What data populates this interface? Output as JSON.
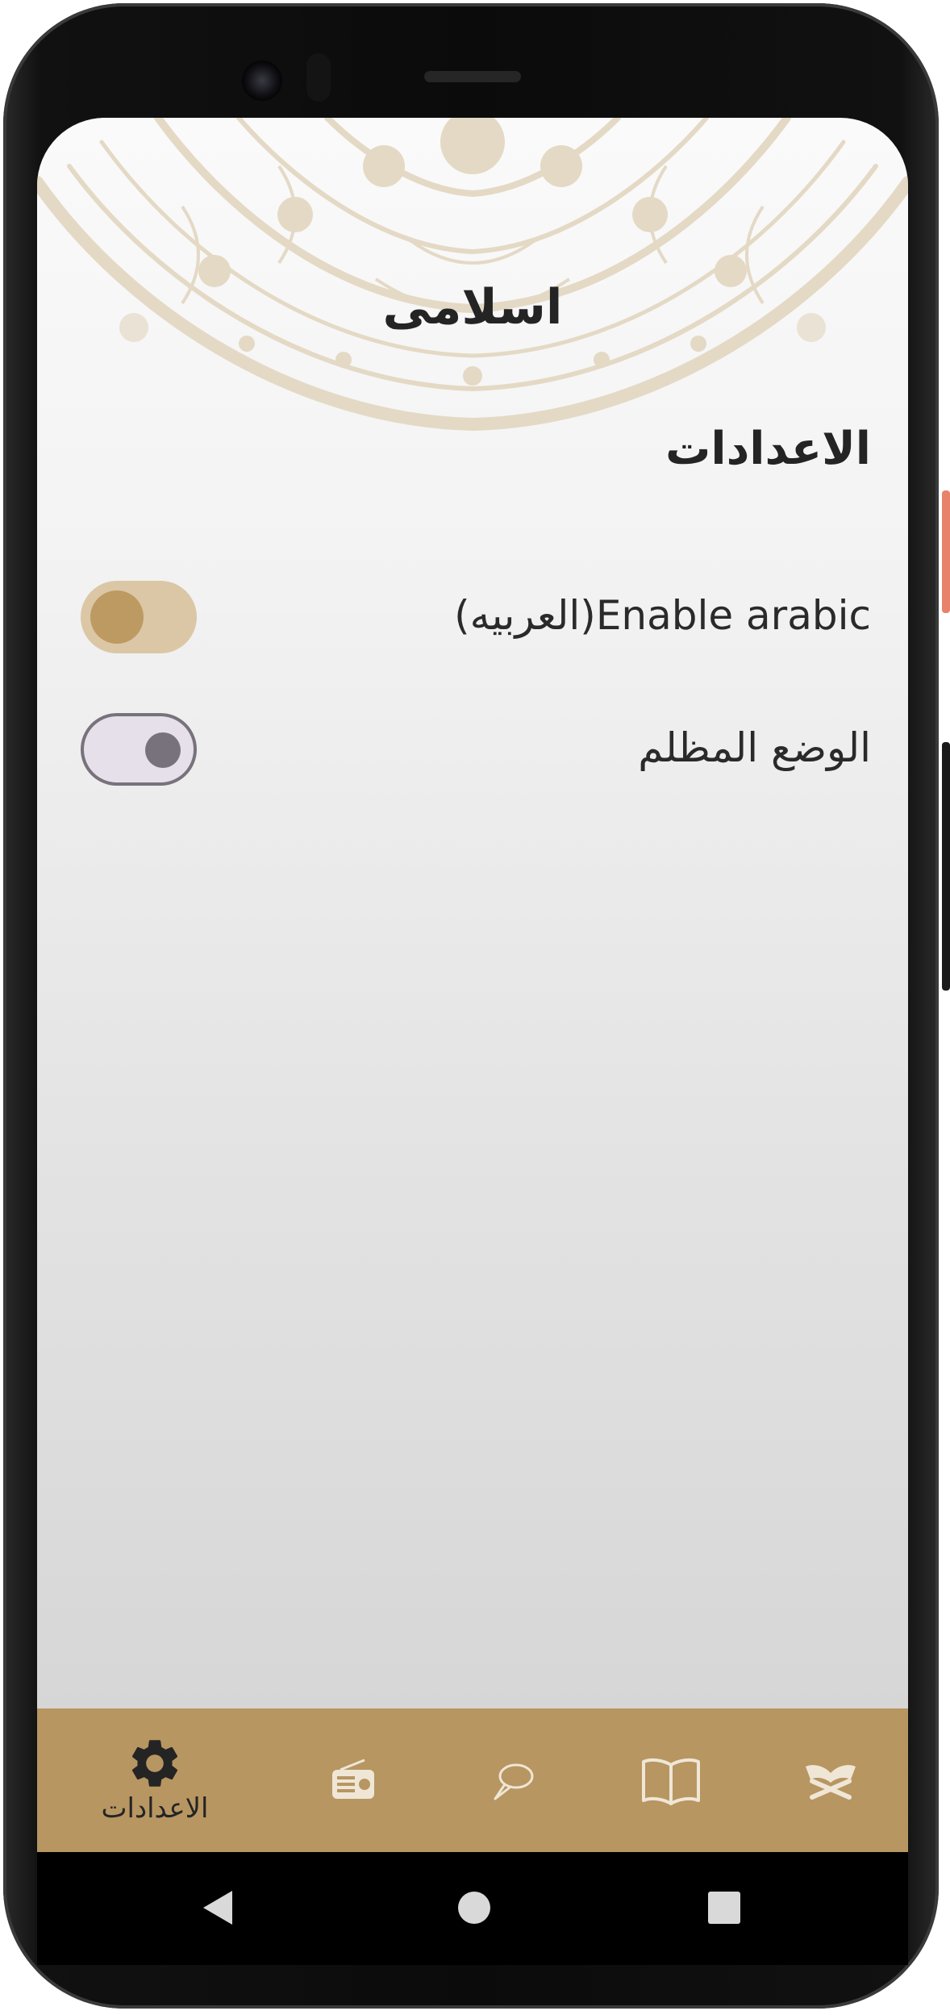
{
  "app": {
    "title": "اسلامى"
  },
  "settings": {
    "section_title": "الاعدادات",
    "rows": [
      {
        "label": "Enable arabic(العربيه)",
        "enabled": true
      },
      {
        "label": "الوضع المظلم",
        "enabled": false
      }
    ]
  },
  "bottom_nav": {
    "active_index": 0,
    "items": [
      {
        "label": "الاعدادات",
        "icon": "gear-icon"
      },
      {
        "label": "",
        "icon": "radio-icon"
      },
      {
        "label": "",
        "icon": "hadith-icon"
      },
      {
        "label": "",
        "icon": "book-icon"
      },
      {
        "label": "",
        "icon": "quran-icon"
      }
    ]
  },
  "system_nav": {
    "back_icon": "triangle-back-icon",
    "home_icon": "circle-home-icon",
    "recent_icon": "square-recent-icon"
  },
  "colors": {
    "accent": "#b79661",
    "switch_on_track": "#dbc7a6",
    "switch_on_thumb": "#be9a63",
    "switch_off_track": "#e6e0ea",
    "switch_off_thumb": "#77727c",
    "mandala": "#e4d9c5",
    "side_button": "#e9826b"
  }
}
